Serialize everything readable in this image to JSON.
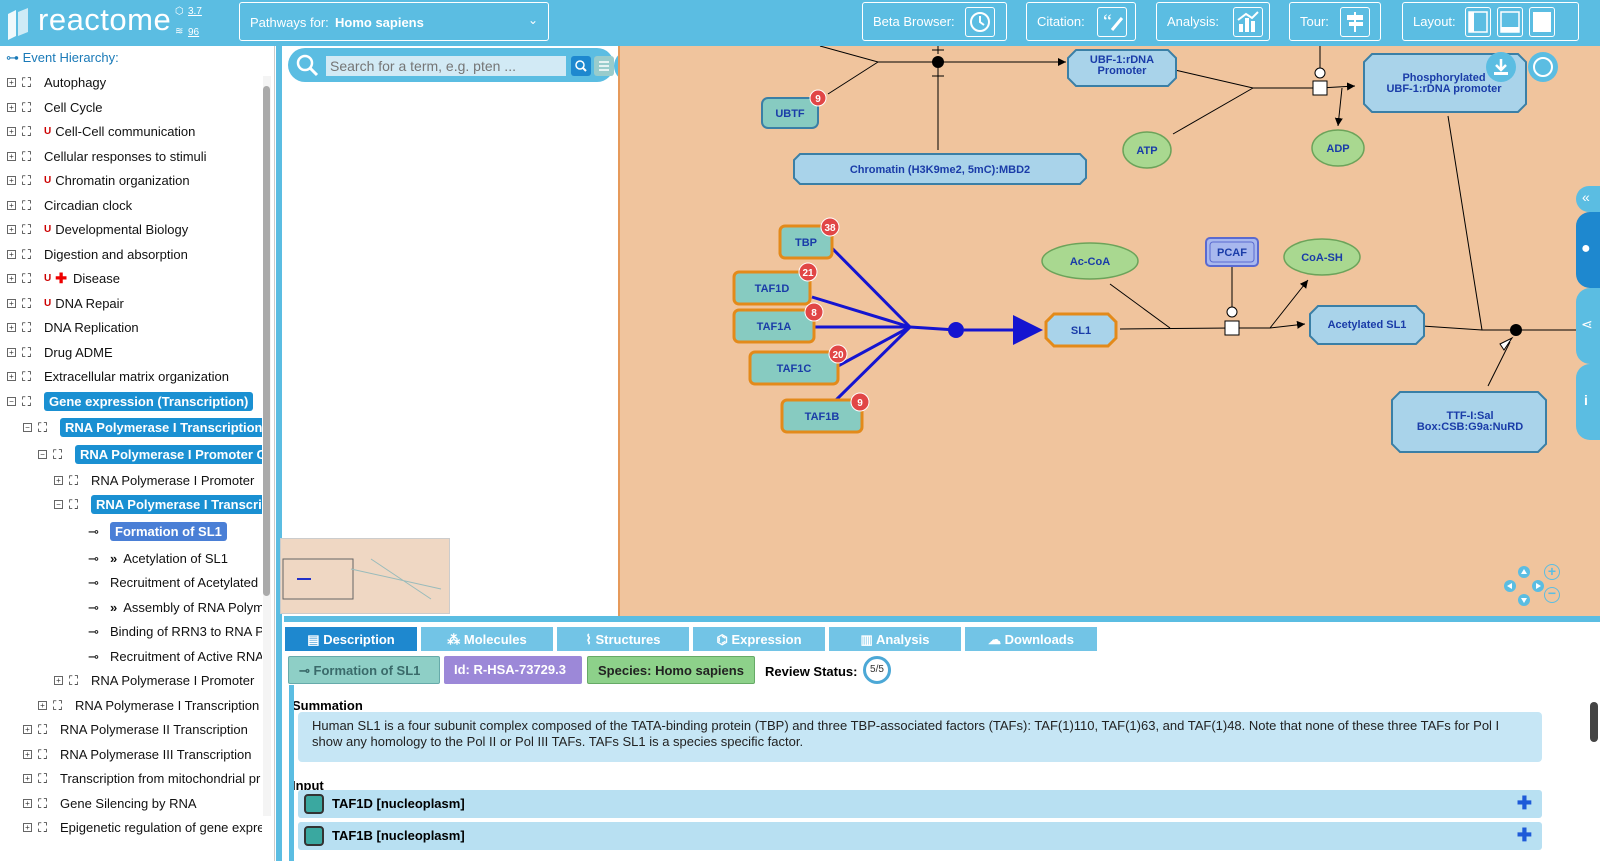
{
  "header": {
    "logo_text": "reactome",
    "version_1": "3.7",
    "version_2": "96",
    "species_label": "Pathways for:",
    "species_value": "Homo sapiens",
    "beta_label": "Beta Browser:",
    "citation_label": "Citation:",
    "analysis_label": "Analysis:",
    "tour_label": "Tour:",
    "layout_label": "Layout:"
  },
  "sidebar": {
    "title": "Event Hierarchy:",
    "items": [
      {
        "label": "Autophagy"
      },
      {
        "label": "Cell Cycle"
      },
      {
        "label": "Cell-Cell communication"
      },
      {
        "label": "Cellular responses to stimuli"
      },
      {
        "label": "Chromatin organization"
      },
      {
        "label": "Circadian clock"
      },
      {
        "label": "Developmental Biology"
      },
      {
        "label": "Digestion and absorption"
      },
      {
        "label": "Disease"
      },
      {
        "label": "DNA Repair"
      },
      {
        "label": "DNA Replication"
      },
      {
        "label": "Drug ADME"
      },
      {
        "label": "Extracellular matrix organization"
      },
      {
        "label": "Gene expression (Transcription)"
      },
      {
        "label": "RNA Polymerase I Transcription"
      },
      {
        "label": "RNA Polymerase I Promoter C"
      },
      {
        "label": "RNA Polymerase I Promoter"
      },
      {
        "label": "RNA Polymerase I Transcri"
      },
      {
        "label": "Formation of SL1"
      },
      {
        "label": "Acetylation of SL1"
      },
      {
        "label": "Recruitment of Acetylated"
      },
      {
        "label": "Assembly of RNA Polym"
      },
      {
        "label": "Binding of RRN3 to RNA P"
      },
      {
        "label": "Recruitment of Active RNA"
      },
      {
        "label": "RNA Polymerase I Promoter"
      },
      {
        "label": "RNA Polymerase I Transcription"
      },
      {
        "label": "RNA Polymerase II Transcription"
      },
      {
        "label": "RNA Polymerase III Transcription"
      },
      {
        "label": "Transcription from mitochondrial pr"
      },
      {
        "label": "Gene Silencing by RNA"
      },
      {
        "label": "Epigenetic regulation of gene expre"
      }
    ]
  },
  "search": {
    "placeholder": "Search for a term, e.g. pten ..."
  },
  "diagram": {
    "nodes": {
      "ubtf": "UBTF",
      "ubtf_count": "9",
      "ubf_promoter_1": "UBF-1:rDNA",
      "ubf_promoter_2": "Promoter",
      "phospho_1": "Phosphorylated",
      "phospho_2": "UBF-1:rDNA promoter",
      "atp": "ATP",
      "adp": "ADP",
      "chromatin": "Chromatin (H3K9me2, 5mC):MBD2",
      "tbp": "TBP",
      "tbp_count": "38",
      "taf1d": "TAF1D",
      "taf1d_count": "21",
      "taf1a": "TAF1A",
      "taf1a_count": "8",
      "taf1c": "TAF1C",
      "taf1c_count": "20",
      "taf1b": "TAF1B",
      "taf1b_count": "9",
      "sl1": "SL1",
      "acoa": "Ac-CoA",
      "pcaf": "PCAF",
      "coash": "CoA-SH",
      "acetylated_sl1": "Acetylated SL1",
      "ttf_1": "TTF-I:Sal",
      "ttf_2": "Box:CSB:G9a:NuRD"
    }
  },
  "tabs": [
    {
      "label": "Description"
    },
    {
      "label": "Molecules"
    },
    {
      "label": "Structures"
    },
    {
      "label": "Expression"
    },
    {
      "label": "Analysis"
    },
    {
      "label": "Downloads"
    }
  ],
  "details": {
    "event_name": "Formation of SL1",
    "id": "Id: R-HSA-73729.3",
    "species": "Species: Homo sapiens",
    "review_label": "Review Status:",
    "review_value": "5/5",
    "summation_title": "Summation",
    "summation_text": "Human SL1 is a four subunit complex composed of the TATA-binding protein (TBP) and three TBP-associated factors (TAFs): TAF(1)110, TAF(1)63, and TAF(1)48. Note that none of these three TAFs for Pol I show any homology to the Pol II or Pol III TAFs. TAFs SL1 is a species specific factor.",
    "input_title": "Input",
    "inputs": [
      {
        "label": "TAF1D [nucleoplasm]"
      },
      {
        "label": "TAF1B [nucleoplasm]"
      }
    ]
  },
  "colors": {
    "brand": "#5bbde2",
    "diagram_bg": "#f0c49d",
    "selected_tab": "#1e88cf",
    "highlight_blue": "#1a90d2"
  }
}
